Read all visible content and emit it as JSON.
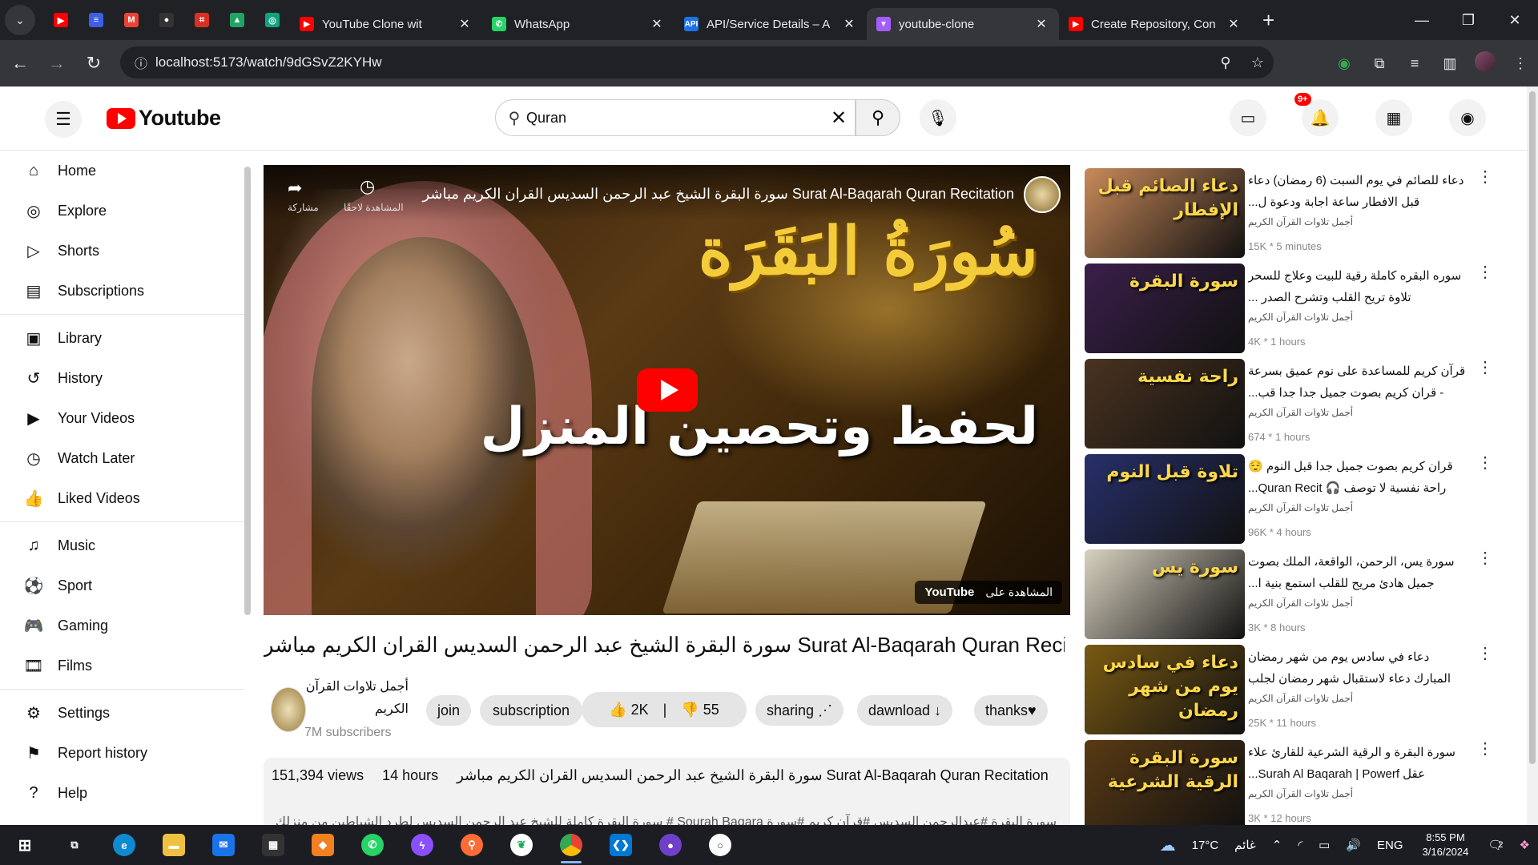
{
  "browser": {
    "pinned_tabs": [
      {
        "icon": "youtube-icon",
        "color": "#ff0000",
        "glyph": "▶"
      },
      {
        "icon": "notes-icon",
        "color": "#3c5ee8",
        "glyph": "≡"
      },
      {
        "icon": "gmail-icon",
        "color": "#ea4335",
        "glyph": "M"
      },
      {
        "icon": "github-icon",
        "color": "#333333",
        "glyph": "●"
      },
      {
        "icon": "bookmark-icon",
        "color": "#d93025",
        "glyph": "⌗"
      },
      {
        "icon": "drive-icon",
        "color": "#1fa463",
        "glyph": "▲"
      },
      {
        "icon": "chatgpt-icon",
        "color": "#10a37f",
        "glyph": "◎"
      }
    ],
    "tabs": [
      {
        "title": "YouTube Clone wit",
        "icon": "youtube-icon",
        "color": "#ff0000",
        "glyph": "▶",
        "active": false
      },
      {
        "title": "WhatsApp",
        "icon": "whatsapp-icon",
        "color": "#25d366",
        "glyph": "✆",
        "active": false
      },
      {
        "title": "API/Service Details – A",
        "icon": "api-icon",
        "color": "#1a73e8",
        "glyph": "API",
        "active": false
      },
      {
        "title": "youtube-clone",
        "icon": "vite-icon",
        "color": "#a45cff",
        "glyph": "▼",
        "active": true
      },
      {
        "title": "Create Repository, Con",
        "icon": "youtube-icon",
        "color": "#ff0000",
        "glyph": "▶",
        "active": false
      }
    ],
    "url": "localhost:5173/watch/9dGSvZ2KYHw"
  },
  "header": {
    "logo_text": "Youtube",
    "search_value": "Quran",
    "notif_badge": "9+"
  },
  "sidebar": {
    "groups": [
      [
        {
          "label": "Home",
          "icon": "home-icon",
          "glyph": "⌂"
        },
        {
          "label": "Explore",
          "icon": "explore-icon",
          "glyph": "◎"
        },
        {
          "label": "Shorts",
          "icon": "shorts-icon",
          "glyph": "▷"
        },
        {
          "label": "Subscriptions",
          "icon": "subscriptions-icon",
          "glyph": "▤"
        }
      ],
      [
        {
          "label": "Library",
          "icon": "library-icon",
          "glyph": "▣"
        },
        {
          "label": "History",
          "icon": "history-icon",
          "glyph": "↺"
        },
        {
          "label": "Your Videos",
          "icon": "your-videos-icon",
          "glyph": "▶"
        },
        {
          "label": "Watch Later",
          "icon": "watch-later-icon",
          "glyph": "◷"
        },
        {
          "label": "Liked Videos",
          "icon": "liked-icon",
          "glyph": "👍"
        }
      ],
      [
        {
          "label": "Music",
          "icon": "music-icon",
          "glyph": "♫"
        },
        {
          "label": "Sport",
          "icon": "sport-icon",
          "glyph": "⚽"
        },
        {
          "label": "Gaming",
          "icon": "gaming-icon",
          "glyph": "🎮"
        },
        {
          "label": "Films",
          "icon": "films-icon",
          "glyph": "🎞"
        }
      ],
      [
        {
          "label": "Settings",
          "icon": "settings-icon",
          "glyph": "⚙"
        },
        {
          "label": "Report history",
          "icon": "flag-icon",
          "glyph": "⚑"
        },
        {
          "label": "Help",
          "icon": "help-icon",
          "glyph": "?"
        }
      ]
    ]
  },
  "player": {
    "overlay_title": "سورة البقرة الشيخ عبد الرحمن السديس القران الكريم مباشر  Surat Al-Baqarah Quran Recitation",
    "share_label": "مشاركة",
    "later_label": "المشاهدة لاحقًا",
    "calligraphy_main": "سُورَةُ البَقَرَة",
    "calligraphy_sub": "لحفظ وتحصين المنزل",
    "watch_on_label": "المشاهدة على",
    "watch_on_logo": "YouTube"
  },
  "video": {
    "title": "سورة البقرة الشيخ عبد الرحمن السديس القران الكريم مباشر Surat Al-Baqarah Quran Recitation",
    "channel_name": "أجمل تلاوات القرآن الكريم",
    "subscribers": "7M subscribers",
    "join_label": "join",
    "subscribe_label": "subscription",
    "likes": "2K",
    "dislikes": "55",
    "share_label": "sharing",
    "download_label": "dawnload",
    "thanks_label": "thanks",
    "views": "151,394 views",
    "age": "14 hours",
    "desc_title": "سورة البقرة الشيخ عبد الرحمن السديس القران الكريم مباشر Surat Al-Baqarah Quran Recitation",
    "desc_tags": "سورة البقرة #عبدالرحمن السديس #قرآن كريم #سورة Sourah Baqara # سورة البقرة كاملة للشيخ عبد الرحمن السديس لطرد الشياطين من منزلك وجلب البركة بإذن الله"
  },
  "recommendations": [
    {
      "title": "دعاء للصائم في يوم السبت (6 رمضان) دعاء قبل الافطار ساعة اجابة ودعوة ل...",
      "channel": "أجمل تلاوات القرآن الكريم",
      "meta": "15K * 5 minutes",
      "thumb_text": "دعاء الصائم قبل الإفطار",
      "thumb_bg": "#c98a5a"
    },
    {
      "title": "سوره البقره كاملة رقية للبيت وعلاج للسحر تلاوة تريح القلب وتشرح الصدر ...",
      "channel": "أجمل تلاوات القرآن الكريم",
      "meta": "4K * 1 hours",
      "thumb_text": "سورة البقرة",
      "thumb_bg": "#3a1f4a"
    },
    {
      "title": "قرآن كريم للمساعدة على نوم عميق بسرعة - قران كريم بصوت جميل جدا جدا قب...",
      "channel": "أجمل تلاوات القرآن الكريم",
      "meta": "674 * 1 hours",
      "thumb_text": "راحة نفسية",
      "thumb_bg": "#4a3320"
    },
    {
      "title": "قران كريم بصوت جميل جدا قبل النوم 😌 راحة نفسية لا توصف 🎧 Quran Recit...",
      "channel": "أجمل تلاوات القرآن الكريم",
      "meta": "96K * 4 hours",
      "thumb_text": "تلاوة قبل النوم",
      "thumb_bg": "#27306a"
    },
    {
      "title": "سورة يس، الرحمن، الواقعة، الملك بصوت جميل هادئ مريح للقلب استمع بنية ا...",
      "channel": "أجمل تلاوات القرآن الكريم",
      "meta": "3K * 8 hours",
      "thumb_text": "سورة يس",
      "thumb_bg": "#d9d2c0"
    },
    {
      "title": "دعاء في سادس يوم من شهر رمضان المبارك دعاء لاستقبال شهر رمضان لجلب الر...",
      "channel": "أجمل تلاوات القرآن الكريم",
      "meta": "25K * 11 hours",
      "thumb_text": "دعاء في سادس يوم من شهر رمضان",
      "thumb_bg": "#7a5a12"
    },
    {
      "title": "سورة البقرة و الرقية الشرعية للقارئ علاء عقل Surah Al Baqarah | Powerf...",
      "channel": "أجمل تلاوات القرآن الكريم",
      "meta": "3K * 12 hours",
      "thumb_text": "سورة البقرة الرقية الشرعية",
      "thumb_bg": "#5a3a14"
    }
  ],
  "taskbar": {
    "weather": "17°C",
    "weather_desc": "غائم",
    "lang": "ENG",
    "time": "8:55 PM",
    "date": "3/16/2024",
    "notif_count": "2"
  }
}
